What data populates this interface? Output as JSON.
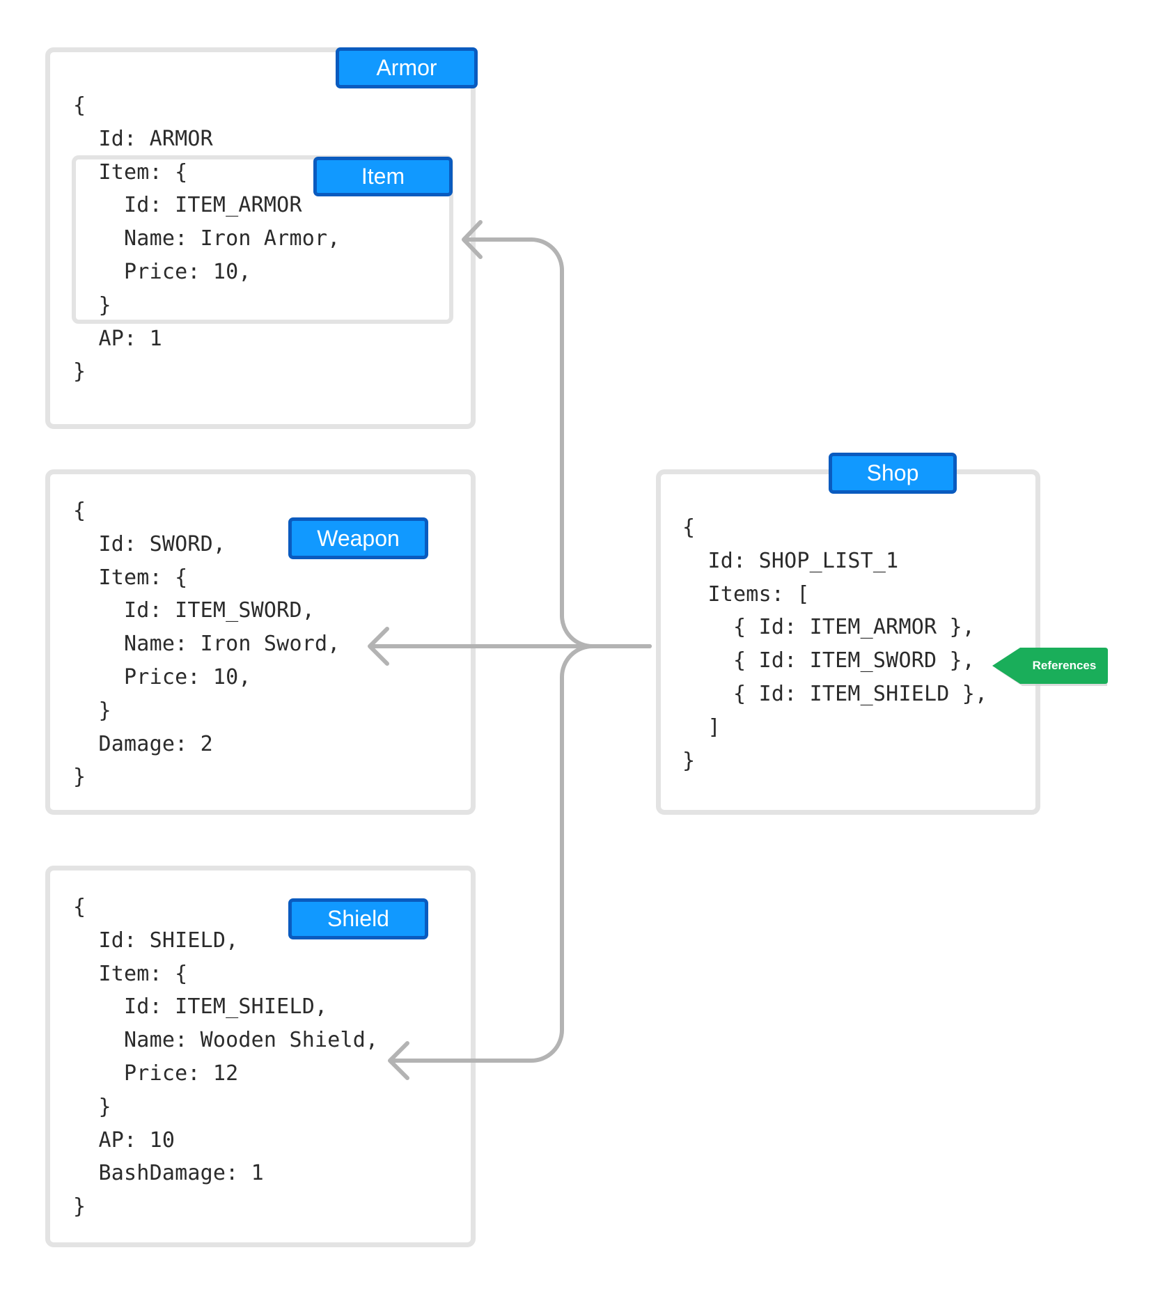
{
  "labels": {
    "armor": "Armor",
    "item": "Item",
    "weapon": "Weapon",
    "shield": "Shield",
    "shop": "Shop",
    "references": "References"
  },
  "armor_code": [
    "{",
    "  Id: ARMOR",
    "  Item: {",
    "    Id: ITEM_ARMOR",
    "    Name: Iron Armor,",
    "    Price: 10,",
    "  }",
    "  AP: 1",
    "}"
  ],
  "weapon_code": [
    "{",
    "  Id: SWORD,",
    "  Item: {",
    "    Id: ITEM_SWORD,",
    "    Name: Iron Sword,",
    "    Price: 10,",
    "  }",
    "  Damage: 2",
    "}"
  ],
  "shield_code": [
    "{",
    "  Id: SHIELD,",
    "  Item: {",
    "    Id: ITEM_SHIELD,",
    "    Name: Wooden Shield,",
    "    Price: 12",
    "  }",
    "  AP: 10",
    "  BashDamage: 1",
    "}"
  ],
  "shop_code": [
    "{",
    "  Id: SHOP_LIST_1",
    "  Items: [",
    "    { Id: ITEM_ARMOR },",
    "    { Id: ITEM_SWORD },",
    "    { Id: ITEM_SHIELD },",
    "  ]",
    "}"
  ],
  "colors": {
    "label_fill": "#1199ff",
    "label_border": "#0a5bbf",
    "box_border": "#e3e3e3",
    "arrow": "#b3b3b3",
    "reference_tag": "#1aae5a"
  }
}
